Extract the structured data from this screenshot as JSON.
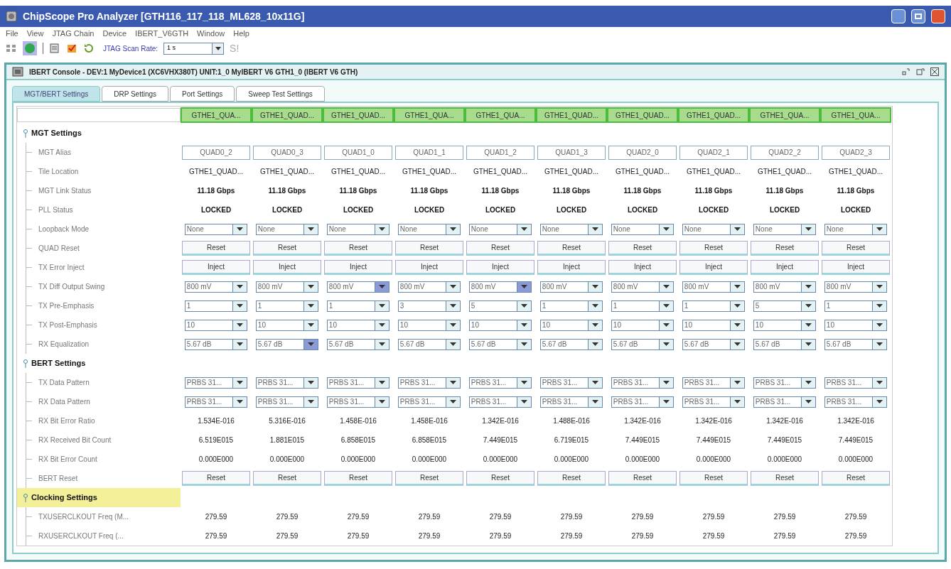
{
  "window": {
    "title": "ChipScope Pro Analyzer [GTH116_117_118_ML628_10x11G]"
  },
  "menu": [
    "File",
    "View",
    "JTAG Chain",
    "Device",
    "IBERT_V6GTH",
    "Window",
    "Help"
  ],
  "toolbar": {
    "scan_rate_label": "JTAG Scan Rate:",
    "scan_rate": "1 s",
    "status": "S!"
  },
  "console": {
    "title": "IBERT Console - DEV:1 MyDevice1 (XC6VHX380T) UNIT:1_0 MyIBERT V6 GTH1_0 (IBERT V6 GTH)"
  },
  "tabs": [
    {
      "label": "MGT/BERT Settings",
      "selected": true
    },
    {
      "label": "DRP Settings",
      "selected": false
    },
    {
      "label": "Port Settings",
      "selected": false
    },
    {
      "label": "Sweep Test Settings",
      "selected": false
    }
  ],
  "columns": [
    "GTHE1_QUA...",
    "GTHE1_QUAD...",
    "GTHE1_QUAD...",
    "GTHE1_QUA...",
    "GTHE1_QUA...",
    "GTHE1_QUAD...",
    "GTHE1_QUAD...",
    "GTHE1_QUAD...",
    "GTHE1_QUA...",
    "GTHE1_QUA..."
  ],
  "sections": [
    {
      "title": "MGT Settings",
      "selected": false,
      "expanded": true,
      "rows": [
        {
          "label": "MGT Alias",
          "kind": "field",
          "cells": [
            "QUAD0_2",
            "QUAD0_3",
            "QUAD1_0",
            "QUAD1_1",
            "QUAD1_2",
            "QUAD1_3",
            "QUAD2_0",
            "QUAD2_1",
            "QUAD2_2",
            "QUAD2_3"
          ]
        },
        {
          "label": "Tile Location",
          "kind": "text",
          "cells": [
            "GTHE1_QUAD...",
            "GTHE1_QUAD...",
            "GTHE1_QUAD...",
            "GTHE1_QUAD...",
            "GTHE1_QUAD...",
            "GTHE1_QUAD...",
            "GTHE1_QUAD...",
            "GTHE1_QUAD...",
            "GTHE1_QUAD...",
            "GTHE1_QUAD..."
          ]
        },
        {
          "label": "MGT Link Status",
          "kind": "bold",
          "cells": [
            "11.18 Gbps",
            "11.18 Gbps",
            "11.18 Gbps",
            "11.18 Gbps",
            "11.18 Gbps",
            "11.18 Gbps",
            "11.18 Gbps",
            "11.18 Gbps",
            "11.18 Gbps",
            "11.18 Gbps"
          ]
        },
        {
          "label": "PLL Status",
          "kind": "bold",
          "cells": [
            "LOCKED",
            "LOCKED",
            "LOCKED",
            "LOCKED",
            "LOCKED",
            "LOCKED",
            "LOCKED",
            "LOCKED",
            "LOCKED",
            "LOCKED"
          ]
        },
        {
          "label": "Loopback Mode",
          "kind": "dropdown",
          "cells": [
            {
              "value": "None",
              "hover": false
            },
            {
              "value": "None",
              "hover": false
            },
            {
              "value": "None",
              "hover": false
            },
            {
              "value": "None",
              "hover": false
            },
            {
              "value": "None",
              "hover": false
            },
            {
              "value": "None",
              "hover": false
            },
            {
              "value": "None",
              "hover": false
            },
            {
              "value": "None",
              "hover": false
            },
            {
              "value": "None",
              "hover": false
            },
            {
              "value": "None",
              "hover": false
            }
          ]
        },
        {
          "label": "QUAD Reset",
          "kind": "button",
          "cells": [
            "Reset",
            "Reset",
            "Reset",
            "Reset",
            "Reset",
            "Reset",
            "Reset",
            "Reset",
            "Reset",
            "Reset"
          ]
        },
        {
          "label": "TX Error Inject",
          "kind": "button",
          "cells": [
            "Inject",
            "Inject",
            "Inject",
            "Inject",
            "Inject",
            "Inject",
            "Inject",
            "Inject",
            "Inject",
            "Inject"
          ]
        },
        {
          "label": "TX Diff Output Swing",
          "kind": "dropdown",
          "cells": [
            {
              "value": "800 mV",
              "hover": false
            },
            {
              "value": "800 mV",
              "hover": false
            },
            {
              "value": "800 mV",
              "hover": true
            },
            {
              "value": "800 mV",
              "hover": false
            },
            {
              "value": "800 mV",
              "hover": true
            },
            {
              "value": "800 mV",
              "hover": false
            },
            {
              "value": "800 mV",
              "hover": false
            },
            {
              "value": "800 mV",
              "hover": false
            },
            {
              "value": "800 mV",
              "hover": false
            },
            {
              "value": "800 mV",
              "hover": false
            }
          ]
        },
        {
          "label": "TX Pre-Emphasis",
          "kind": "dropdown",
          "cells": [
            {
              "value": "1",
              "hover": false
            },
            {
              "value": "1",
              "hover": false
            },
            {
              "value": "1",
              "hover": false
            },
            {
              "value": "3",
              "hover": false
            },
            {
              "value": "5",
              "hover": false
            },
            {
              "value": "1",
              "hover": false
            },
            {
              "value": "1",
              "hover": false
            },
            {
              "value": "1",
              "hover": false
            },
            {
              "value": "5",
              "hover": false
            },
            {
              "value": "1",
              "hover": false
            }
          ]
        },
        {
          "label": "TX Post-Emphasis",
          "kind": "dropdown",
          "cells": [
            {
              "value": "10",
              "hover": false
            },
            {
              "value": "10",
              "hover": false
            },
            {
              "value": "10",
              "hover": false
            },
            {
              "value": "10",
              "hover": false
            },
            {
              "value": "10",
              "hover": false
            },
            {
              "value": "10",
              "hover": false
            },
            {
              "value": "10",
              "hover": false
            },
            {
              "value": "10",
              "hover": false
            },
            {
              "value": "10",
              "hover": false
            },
            {
              "value": "10",
              "hover": false
            }
          ]
        },
        {
          "label": "RX Equalization",
          "kind": "dropdown",
          "cells": [
            {
              "value": "5.67 dB",
              "hover": false
            },
            {
              "value": "5.67 dB",
              "hover": true
            },
            {
              "value": "5.67 dB",
              "hover": false
            },
            {
              "value": "5.67 dB",
              "hover": false
            },
            {
              "value": "5.67 dB",
              "hover": false
            },
            {
              "value": "5.67 dB",
              "hover": false
            },
            {
              "value": "5.67 dB",
              "hover": false
            },
            {
              "value": "5.67 dB",
              "hover": false
            },
            {
              "value": "5.67 dB",
              "hover": false
            },
            {
              "value": "5.67 dB",
              "hover": false
            }
          ]
        }
      ]
    },
    {
      "title": "BERT Settings",
      "selected": false,
      "expanded": true,
      "rows": [
        {
          "label": "TX Data Pattern",
          "kind": "dropdown",
          "cells": [
            {
              "value": "PRBS 31...",
              "hover": false
            },
            {
              "value": "PRBS 31...",
              "hover": false
            },
            {
              "value": "PRBS 31...",
              "hover": false
            },
            {
              "value": "PRBS 31...",
              "hover": false
            },
            {
              "value": "PRBS 31...",
              "hover": false
            },
            {
              "value": "PRBS 31...",
              "hover": false
            },
            {
              "value": "PRBS 31...",
              "hover": false
            },
            {
              "value": "PRBS 31...",
              "hover": false
            },
            {
              "value": "PRBS 31...",
              "hover": false
            },
            {
              "value": "PRBS 31...",
              "hover": false
            }
          ]
        },
        {
          "label": "RX Data Pattern",
          "kind": "dropdown",
          "cells": [
            {
              "value": "PRBS 31...",
              "hover": false
            },
            {
              "value": "PRBS 31...",
              "hover": false
            },
            {
              "value": "PRBS 31...",
              "hover": false
            },
            {
              "value": "PRBS 31...",
              "hover": false
            },
            {
              "value": "PRBS 31...",
              "hover": false
            },
            {
              "value": "PRBS 31...",
              "hover": false
            },
            {
              "value": "PRBS 31...",
              "hover": false
            },
            {
              "value": "PRBS 31...",
              "hover": false
            },
            {
              "value": "PRBS 31...",
              "hover": false
            },
            {
              "value": "PRBS 31...",
              "hover": false
            }
          ]
        },
        {
          "label": "RX Bit Error Ratio",
          "kind": "text",
          "cells": [
            "1.534E-016",
            "5.316E-016",
            "1.458E-016",
            "1.458E-016",
            "1.342E-016",
            "1.488E-016",
            "1.342E-016",
            "1.342E-016",
            "1.342E-016",
            "1.342E-016"
          ]
        },
        {
          "label": "RX Received Bit Count",
          "kind": "text",
          "cells": [
            "6.519E015",
            "1.881E015",
            "6.858E015",
            "6.858E015",
            "7.449E015",
            "6.719E015",
            "7.449E015",
            "7.449E015",
            "7.449E015",
            "7.449E015"
          ]
        },
        {
          "label": "RX Bit Error Count",
          "kind": "text",
          "cells": [
            "0.000E000",
            "0.000E000",
            "0.000E000",
            "0.000E000",
            "0.000E000",
            "0.000E000",
            "0.000E000",
            "0.000E000",
            "0.000E000",
            "0.000E000"
          ]
        },
        {
          "label": "BERT Reset",
          "kind": "button",
          "cells": [
            "Reset",
            "Reset",
            "Reset",
            "Reset",
            "Reset",
            "Reset",
            "Reset",
            "Reset",
            "Reset",
            "Reset"
          ]
        }
      ]
    },
    {
      "title": "Clocking Settings",
      "selected": true,
      "expanded": true,
      "rows": [
        {
          "label": "TXUSERCLKOUT Freq (M...",
          "kind": "text",
          "cells": [
            "279.59",
            "279.59",
            "279.59",
            "279.59",
            "279.59",
            "279.59",
            "279.59",
            "279.59",
            "279.59",
            "279.59"
          ]
        },
        {
          "label": "RXUSERCLKOUT Freq (...",
          "kind": "text",
          "cells": [
            "279.59",
            "279.59",
            "279.59",
            "279.59",
            "279.59",
            "279.59",
            "279.59",
            "279.59",
            "279.59",
            "279.59"
          ]
        }
      ]
    }
  ]
}
